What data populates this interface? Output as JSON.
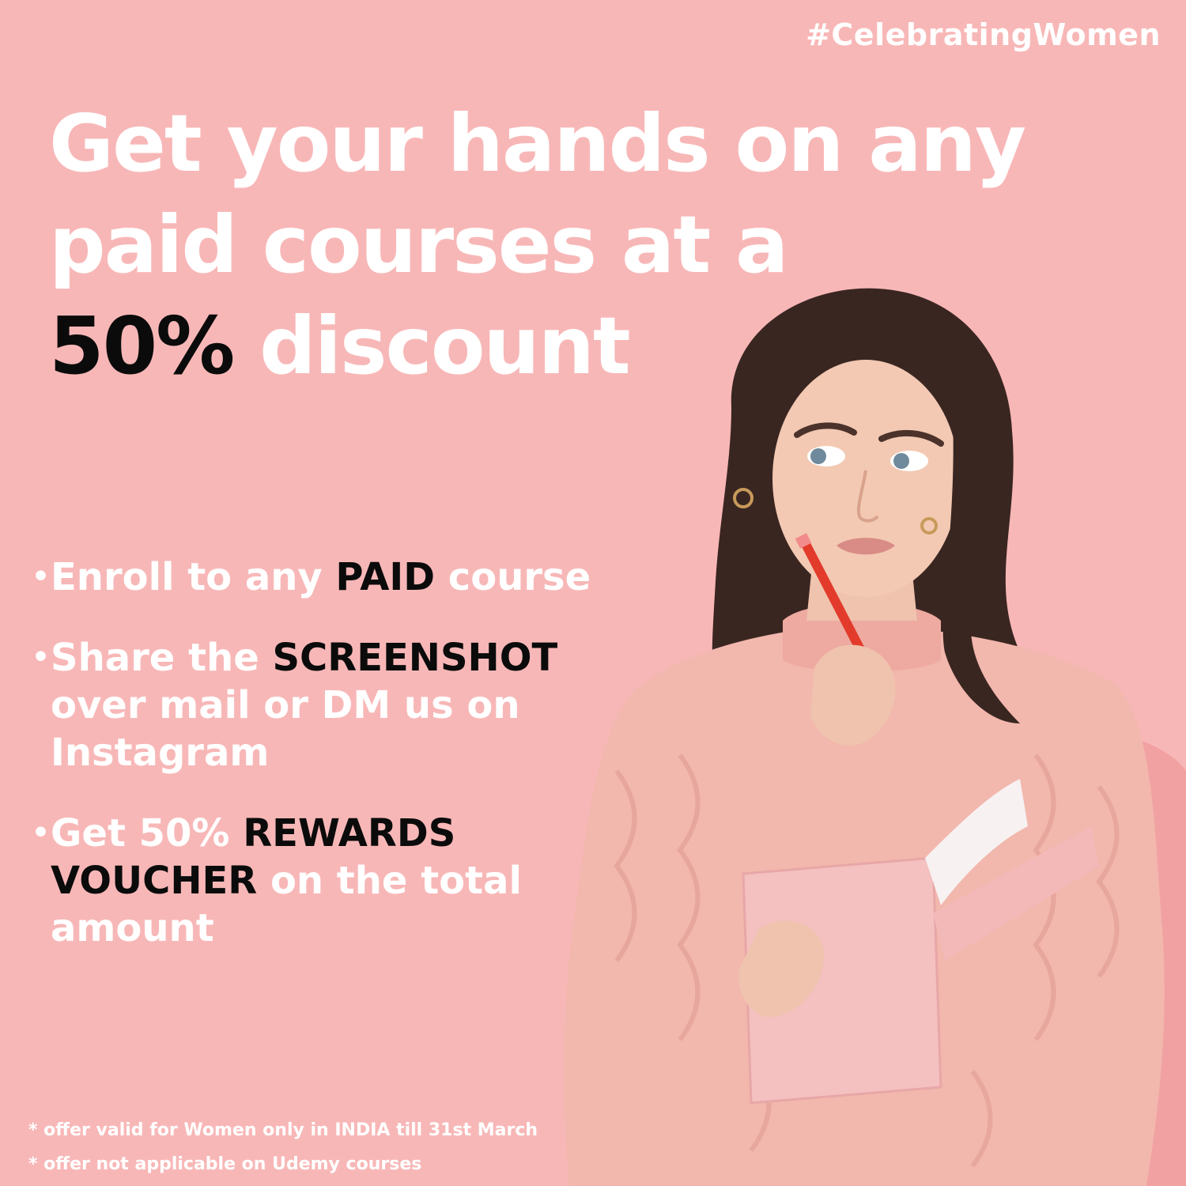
{
  "hashtag": "#CelebratingWomen",
  "headline": {
    "line1": "Get your hands on any",
    "line2": "paid courses at a",
    "line3_highlight": "50%",
    "line3_rest": " discount"
  },
  "bullets": [
    {
      "pre": "Enroll to any ",
      "highlight": "PAID",
      "post": " course"
    },
    {
      "pre": "Share the ",
      "highlight": "SCREENSHOT",
      "post": " over mail or DM us on Instagram"
    },
    {
      "pre": "Get 50% ",
      "highlight": "REWARDS VOUCHER",
      "post": " on the  total amount"
    }
  ],
  "notes": [
    "* offer valid for Women only in INDIA till 31st March",
    "* offer not applicable on Udemy courses"
  ],
  "colors": {
    "background": "#f8b7b7",
    "text_light": "#ffffff",
    "text_dark": "#0b0b0b",
    "sweater": "#f2b7ad",
    "hair": "#3a2621"
  }
}
